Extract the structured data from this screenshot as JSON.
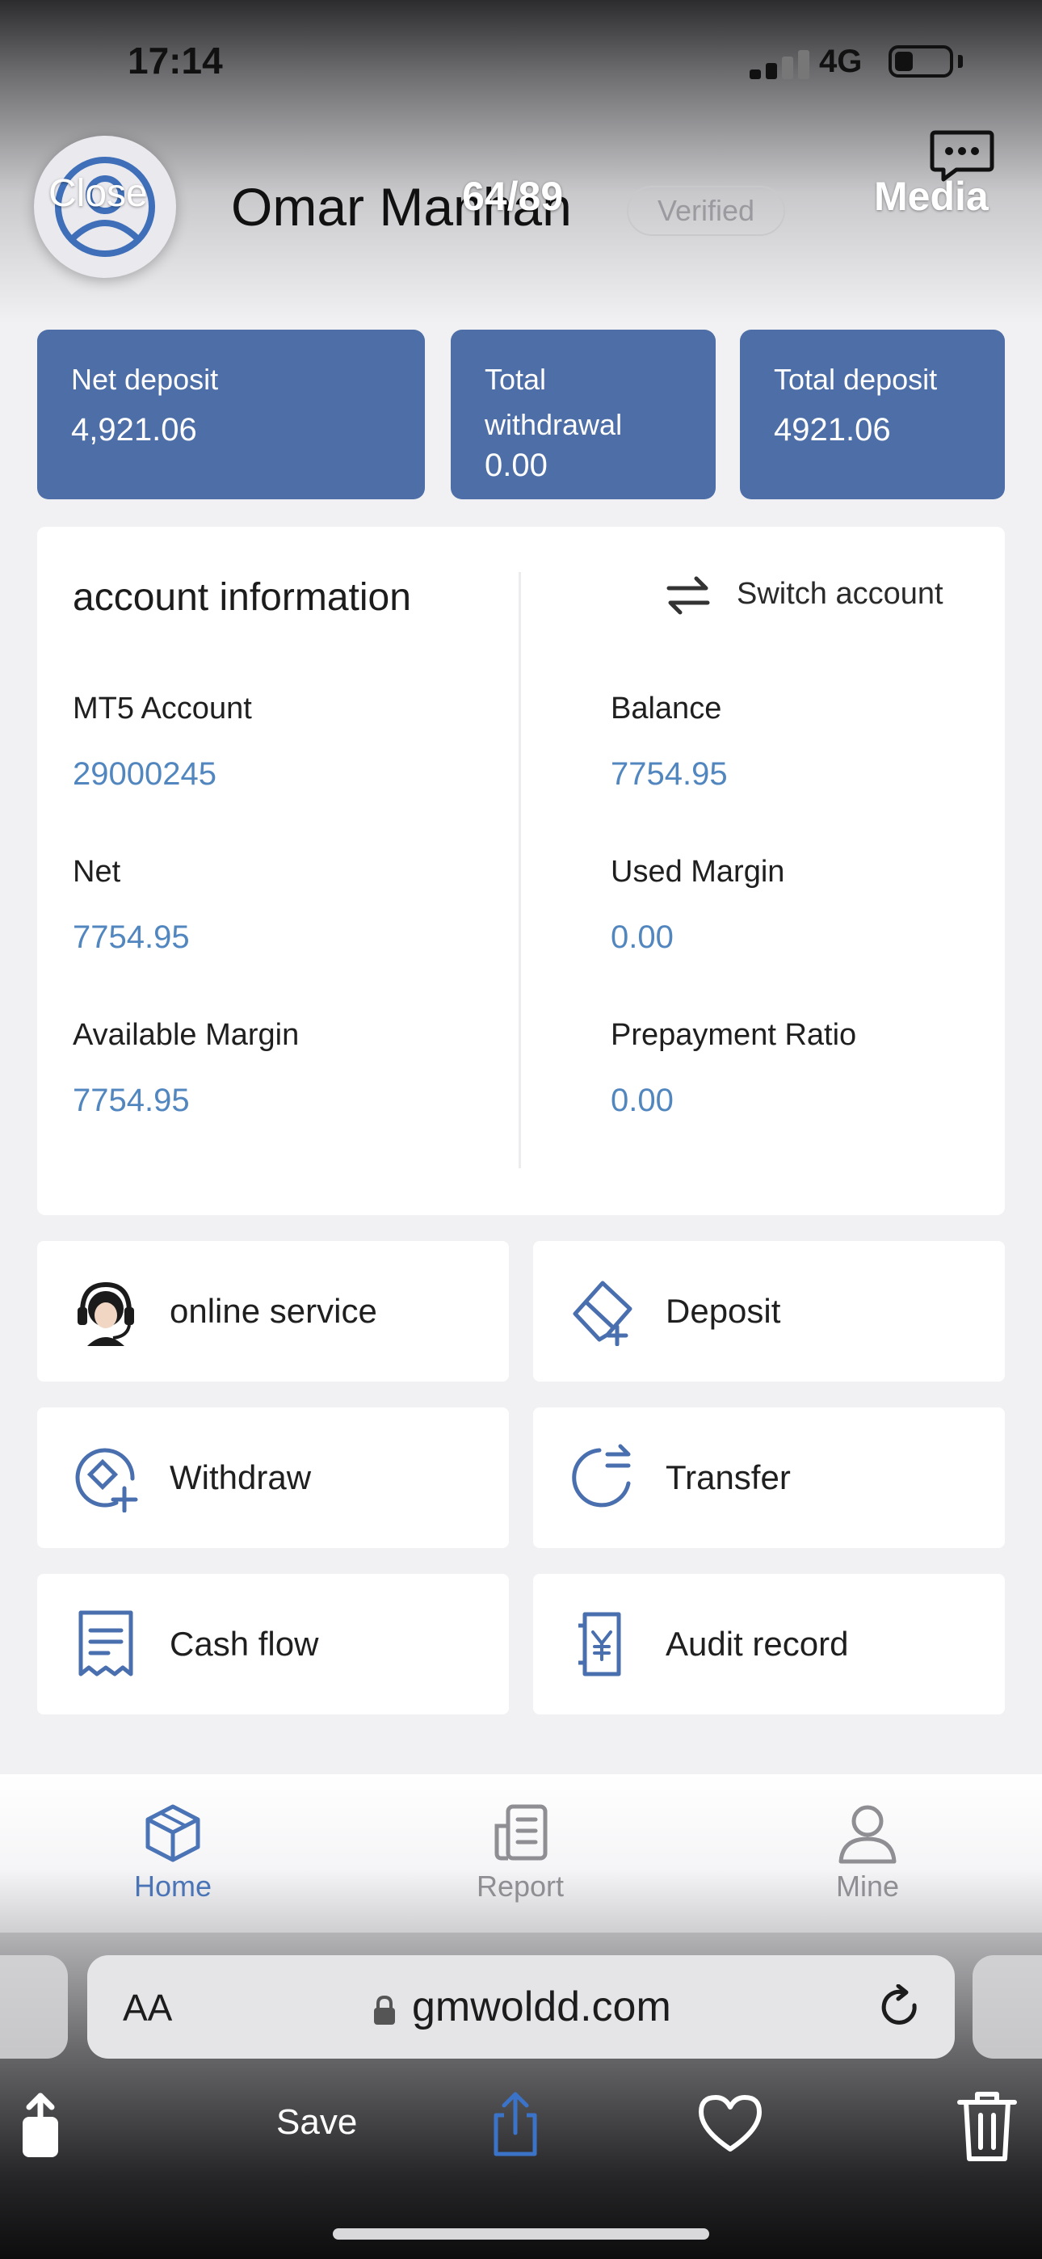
{
  "status_bar": {
    "time": "17:14",
    "network": "4G"
  },
  "header": {
    "close_label": "Close",
    "user_name": "Omar Manhan",
    "counter": "64/89",
    "verified_label": "Verified",
    "media_label": "Media"
  },
  "stats": [
    {
      "label": "Net deposit",
      "value": "4,921.06"
    },
    {
      "label": "Total withdrawal",
      "value": "0.00"
    },
    {
      "label": "Total deposit",
      "value": "4921.06"
    }
  ],
  "account": {
    "title": "account information",
    "switch_label": "Switch account",
    "fields": [
      {
        "label": "MT5 Account",
        "value": "29000245"
      },
      {
        "label": "Balance",
        "value": "7754.95"
      },
      {
        "label": "Net",
        "value": "7754.95"
      },
      {
        "label": "Used Margin",
        "value": "0.00"
      },
      {
        "label": "Available Margin",
        "value": "7754.95"
      },
      {
        "label": "Prepayment Ratio",
        "value": "0.00"
      }
    ]
  },
  "actions": [
    {
      "label": "online service",
      "icon": "headset-icon"
    },
    {
      "label": "Deposit",
      "icon": "card-add-icon"
    },
    {
      "label": "Withdraw",
      "icon": "withdraw-icon"
    },
    {
      "label": "Transfer",
      "icon": "transfer-icon"
    },
    {
      "label": "Cash flow",
      "icon": "receipt-icon"
    },
    {
      "label": "Audit record",
      "icon": "yen-document-icon"
    }
  ],
  "nav": [
    {
      "label": "Home",
      "icon": "cube-icon",
      "active": true
    },
    {
      "label": "Report",
      "icon": "report-icon",
      "active": false
    },
    {
      "label": "Mine",
      "icon": "user-icon",
      "active": false
    }
  ],
  "browser": {
    "aa_label": "AA",
    "url": "gmwoldd.com",
    "save_label": "Save"
  },
  "colors": {
    "accent": "#4d6ea6",
    "value_blue": "#5286bf",
    "nav_active": "#4a74b6",
    "nav_inactive": "#8e8e93"
  }
}
